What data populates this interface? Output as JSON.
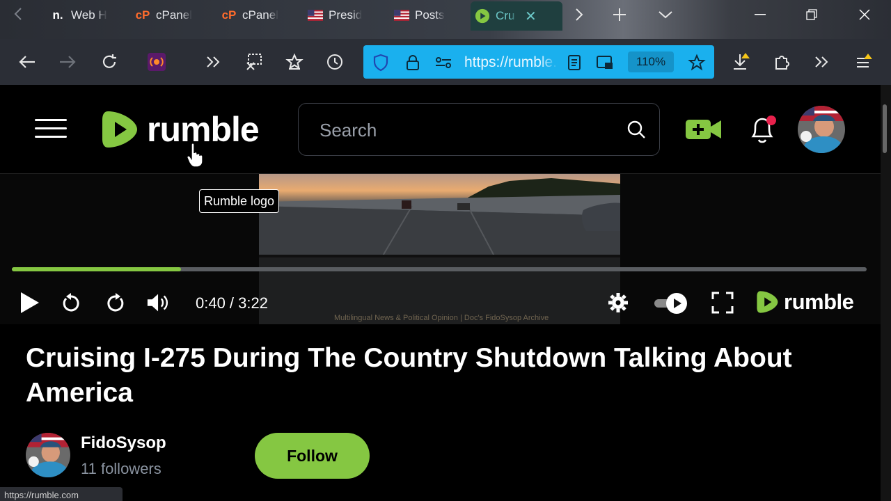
{
  "browser": {
    "tabs": [
      {
        "title": "Web H",
        "favicon": "n.",
        "favicon_color": "#ffffff"
      },
      {
        "title": "cPanel",
        "favicon": "cP",
        "favicon_color": "#ff6c2c"
      },
      {
        "title": "cPanel",
        "favicon": "cP",
        "favicon_color": "#ff6c2c"
      },
      {
        "title": "Presid",
        "favicon": "us-flag-icon"
      },
      {
        "title": "Posts",
        "favicon": "us-flag-icon"
      },
      {
        "title": "Cru",
        "favicon": "rumble-icon",
        "active": true
      }
    ],
    "url": "https://rumble.com",
    "zoom": "110%",
    "status_url": "https://rumble.com"
  },
  "rumble": {
    "logo_text": "rumble",
    "search_placeholder": "Search",
    "brand_color": "#85c742"
  },
  "player": {
    "time_display": "0:40 / 3:22",
    "progress": 0.198,
    "watermark": "Multilingual News & Political Opinion | Doc's FidoSysop Archive",
    "logo_text": "rumble",
    "tooltip": "Rumble logo"
  },
  "video": {
    "title": "Cruising I-275 During The Country Shutdown Talking About America"
  },
  "channel": {
    "name": "FidoSysop",
    "followers": "11 followers",
    "follow_label": "Follow"
  }
}
